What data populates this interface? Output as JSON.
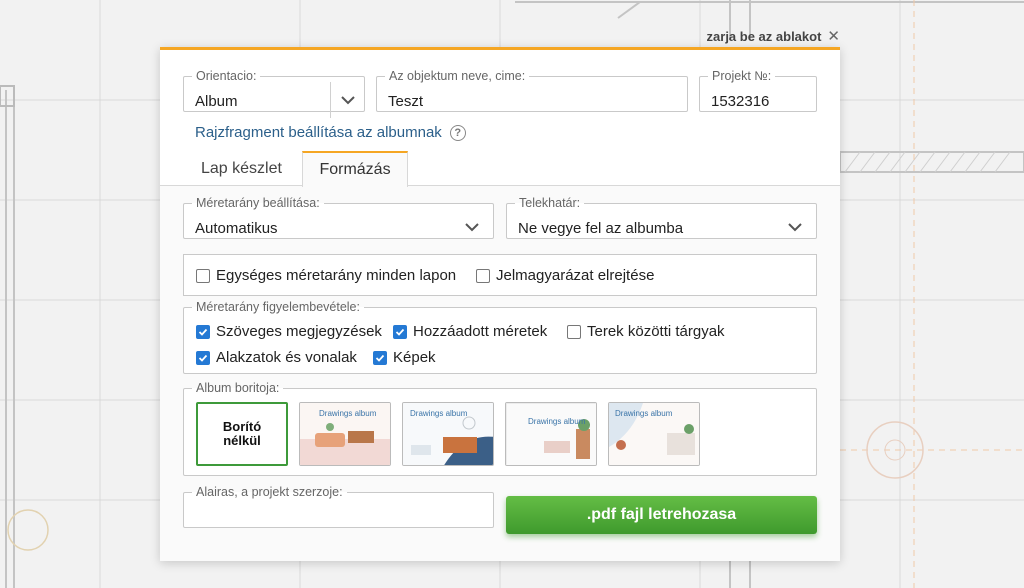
{
  "close": {
    "label": "zarja be az ablakot",
    "icon": "close-icon"
  },
  "top": {
    "orientation": {
      "legend": "Orientacio:",
      "value": "Album"
    },
    "object_name": {
      "legend": "Az objektum neve, cime:",
      "value": "Teszt"
    },
    "project_no": {
      "legend": "Projekt №:",
      "value": "1532316"
    },
    "fragment_link": "Rajzfragment beállítása az albumnak",
    "help_icon": "?"
  },
  "tabs": [
    {
      "label": "Lap készlet",
      "active": false
    },
    {
      "label": "Formázás",
      "active": true
    }
  ],
  "format": {
    "scale": {
      "legend": "Méretarány beállítása:",
      "value": "Automatikus"
    },
    "lot_boundary": {
      "legend": "Telekhatár:",
      "value": "Ne vegye fel az albumba"
    },
    "options": [
      {
        "label": "Egységes méretarány minden lapon",
        "checked": false
      },
      {
        "label": "Jelmagyarázat elrejtése",
        "checked": false
      }
    ],
    "scale_consider": {
      "legend": "Méretarány figyelembevétele:",
      "items": [
        {
          "label": "Szöveges megjegyzések",
          "checked": true
        },
        {
          "label": "Hozzáadott méretek",
          "checked": true
        },
        {
          "label": "Terek közötti tárgyak",
          "checked": false
        },
        {
          "label": "Alakzatok és vonalak",
          "checked": true
        },
        {
          "label": "Képek",
          "checked": true
        }
      ]
    },
    "cover": {
      "legend": "Album boritoja:",
      "none_label": "Borító\nnélkül",
      "thumb_title": "Drawings album"
    },
    "signature": {
      "legend": "Alairas, a projekt szerzoje:",
      "value": ""
    },
    "pdf_button": ".pdf fajl letrehozasa"
  },
  "colors": {
    "accent": "#f5a623",
    "primary_button": "#4caf38",
    "checkbox": "#2479d4",
    "link": "#2b5f8a"
  }
}
